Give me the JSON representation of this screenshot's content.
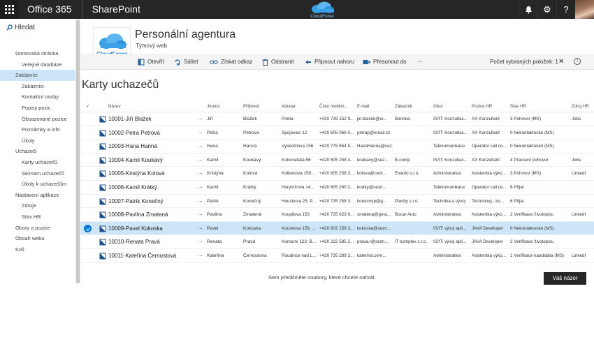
{
  "suite": {
    "title": "Office 365",
    "app": "SharePoint",
    "logo_text": "CloudForce",
    "bell_glyph": "🔔",
    "gear_glyph": "⚙",
    "help_glyph": "?"
  },
  "nav": {
    "search_label": "Hledat",
    "items": [
      {
        "label": "Domovská stránka",
        "level": 1,
        "selected": false
      },
      {
        "label": "Veřejné databáze",
        "level": 2,
        "selected": false
      },
      {
        "label": "Zakázníci",
        "level": 1,
        "selected": true
      },
      {
        "label": "Zakázníci",
        "level": 2,
        "selected": false
      },
      {
        "label": "Kontaktní osoby",
        "level": 2,
        "selected": false
      },
      {
        "label": "Popisy pozic",
        "level": 2,
        "selected": false
      },
      {
        "label": "Obsazované pozice",
        "level": 2,
        "selected": false
      },
      {
        "label": "Poznámky a info",
        "level": 2,
        "selected": false
      },
      {
        "label": "Úkoly",
        "level": 2,
        "selected": false
      },
      {
        "label": "Uchazeči",
        "level": 1,
        "selected": false
      },
      {
        "label": "Karty uchazečů",
        "level": 2,
        "selected": false
      },
      {
        "label": "Seznam uchazečů",
        "level": 2,
        "selected": false
      },
      {
        "label": "Úkoly k uchazečům",
        "level": 2,
        "selected": false
      },
      {
        "label": "Nastavení aplikace",
        "level": 1,
        "selected": false
      },
      {
        "label": "Zdroje",
        "level": 2,
        "selected": false
      },
      {
        "label": "Stav HR",
        "level": 2,
        "selected": false
      },
      {
        "label": "Obory a pozice",
        "level": 1,
        "selected": false
      },
      {
        "label": "Obsah webu",
        "level": 1,
        "selected": false
      },
      {
        "label": "Koš",
        "level": 1,
        "selected": false
      }
    ]
  },
  "site": {
    "logo_text": "CloudForce",
    "title": "Personální agentura",
    "subtitle": "Týmový web"
  },
  "commands": {
    "open": "Otevřít",
    "share": "Sdílet",
    "get_link": "Získat odkaz",
    "delete": "Odstranit",
    "pin_top": "Připnout nahoru",
    "move_to": "Přesunout do",
    "more": "···",
    "selected_count": "Počet vybraných položek: 1",
    "close": "✕",
    "info": "i"
  },
  "list": {
    "title": "Karty uchazečů",
    "check_header": "✓",
    "columns": [
      "Název",
      "Jméno",
      "Příjmení",
      "Adresa",
      "Číslo mobilní...",
      "E-mail",
      "Zákazník",
      "Obor",
      "Pozice HR",
      "Stav HR",
      "Zdroj HR"
    ],
    "rows": [
      {
        "name": "10001-Jiří Blažek",
        "jmeno": "Jiří",
        "prijmeni": "Blažek",
        "adresa": "Praha",
        "mobil": "+420 739 152 9...",
        "email": "jiri.blazek@w...",
        "zakaznik": "Bannka",
        "obor": "IS/IT: Konzultac...",
        "pozice": "AX Konzultant",
        "stav": "3 Pohovor (MS)",
        "zdroj": "Jobs",
        "selected": false
      },
      {
        "name": "10002-Petra Petrová",
        "jmeno": "Petra",
        "prijmeni": "Petrova",
        "adresa": "Spojovací 12",
        "mobil": "+420 605 066 0...",
        "email": "petrap@email.cz",
        "zakaznik": "",
        "obor": "IS/IT: Konzultac...",
        "pozice": "AX Konzultant",
        "stav": "0 Nekontaktován (MS)",
        "zdroj": "",
        "selected": false
      },
      {
        "name": "10003-Hana Hanná",
        "jmeno": "Hana",
        "prijmeni": "Hanná",
        "adresa": "Vyskočilova 156",
        "mobil": "+420 775 654 9...",
        "email": "HanaHanna@sez...",
        "zakaznik": "",
        "obor": "Telekomunikace",
        "pozice": "Operátor call ce...",
        "stav": "0 Nekontaktován (MS)",
        "zdroj": "",
        "selected": false
      },
      {
        "name": "10004-Kamil Koukavý",
        "jmeno": "Kamil",
        "prijmeni": "Koukavý",
        "adresa": "Kolovratská 96",
        "mobil": "+420 605 258 3...",
        "email": "koukavy@sez...",
        "zakaznik": "B-comp",
        "obor": "IS/IT: Konzultac...",
        "pozice": "AX Konzultant",
        "stav": "4 Pracovní pohovor",
        "zdroj": "Jobs",
        "selected": false
      },
      {
        "name": "10005-Kristýna Kolová",
        "jmeno": "Kristýna",
        "prijmeni": "Kolová",
        "adresa": "Kolbenova 158...",
        "mobil": "+420 605 258 3...",
        "email": "kolova@cent...",
        "zakaznik": "Evanto s.r.o.",
        "obor": "Administrativa",
        "pozice": "Asistentka výko...",
        "stav": "3 Pohovor (MS)",
        "zdroj": "LinkedI",
        "selected": false
      },
      {
        "name": "10006-Kamil Krátký",
        "jmeno": "Kamil",
        "prijmeni": "Krátký",
        "adresa": "Horymírova 14...",
        "mobil": "+420 605 260 2...",
        "email": "kratky@sezn...",
        "zakaznik": "",
        "obor": "Telekomunikace",
        "pozice": "Operátor call ce...",
        "stav": "6 Přijat",
        "zdroj": "",
        "selected": false
      },
      {
        "name": "10007-Patrik Konečný",
        "jmeno": "Patrik",
        "prijmeni": "Konečný",
        "adresa": "Houskova 25, P...",
        "mobil": "+420 735 258 3...",
        "email": "konecnyp@g...",
        "zakaznik": "Plavby s.r.o.",
        "obor": "Technika a vývoj",
        "pozice": "Technolog - ko...",
        "stav": "6 Přijat",
        "zdroj": "",
        "selected": false
      },
      {
        "name": "10008-Pavlína Zmatená",
        "jmeno": "Pavlina",
        "prijmeni": "Zmatená",
        "adresa": "Koupilova 153",
        "mobil": "+420 725 623 9...",
        "email": "zmatena@gma...",
        "zakaznik": "Bocar Auto",
        "obor": "Administrativa",
        "pozice": "Asistentka výko...",
        "stav": "2 Verifikace životopisu",
        "zdroj": "LinkedI",
        "selected": false
      },
      {
        "name": "10009-Pavel Kokoska",
        "jmeno": "Pavel",
        "prijmeni": "Kokoska",
        "adresa": "Kouskova 159, ...",
        "mobil": "+420 602 159 3...",
        "email": "kokoska@sezn...",
        "zakaznik": "",
        "obor": "IS/IT: vývoj apli...",
        "pozice": "JAVA Developer",
        "stav": "0 Nekontaktován (MS)",
        "zdroj": "",
        "selected": true
      },
      {
        "name": "10010-Renata Pravá",
        "jmeno": "Renata",
        "prijmeni": "Pravá",
        "adresa": "Komorní 123, B...",
        "mobil": "+420 222 585 2...",
        "email": "prava.r@sezn...",
        "zakaznik": "IT komplex s.r.o.",
        "obor": "IS/IT: vývoj apli...",
        "pozice": "JAVA Developer",
        "stav": "2 Verifikace životopisu",
        "zdroj": "",
        "selected": false
      },
      {
        "name": "10011-Kateřina Černostová",
        "jmeno": "Kateřina",
        "prijmeni": "Černostova",
        "adresa": "Roudnice nad L...",
        "mobil": "+420 735 289 3...",
        "email": "katerina.cern...",
        "zakaznik": "",
        "obor": "Administrativa",
        "pozice": "Asistentka výko...",
        "stav": "1 Verifikace kandidáta (MS)",
        "zdroj": "LinkedI",
        "selected": false
      }
    ],
    "drop_hint": "Sem přetáhněte soubory, které chcete nahrát."
  },
  "feedback": {
    "label": "Váš názor"
  },
  "colors": {
    "accent": "#0078d7",
    "suitebar": "#262626",
    "selection": "#cde6f7"
  }
}
